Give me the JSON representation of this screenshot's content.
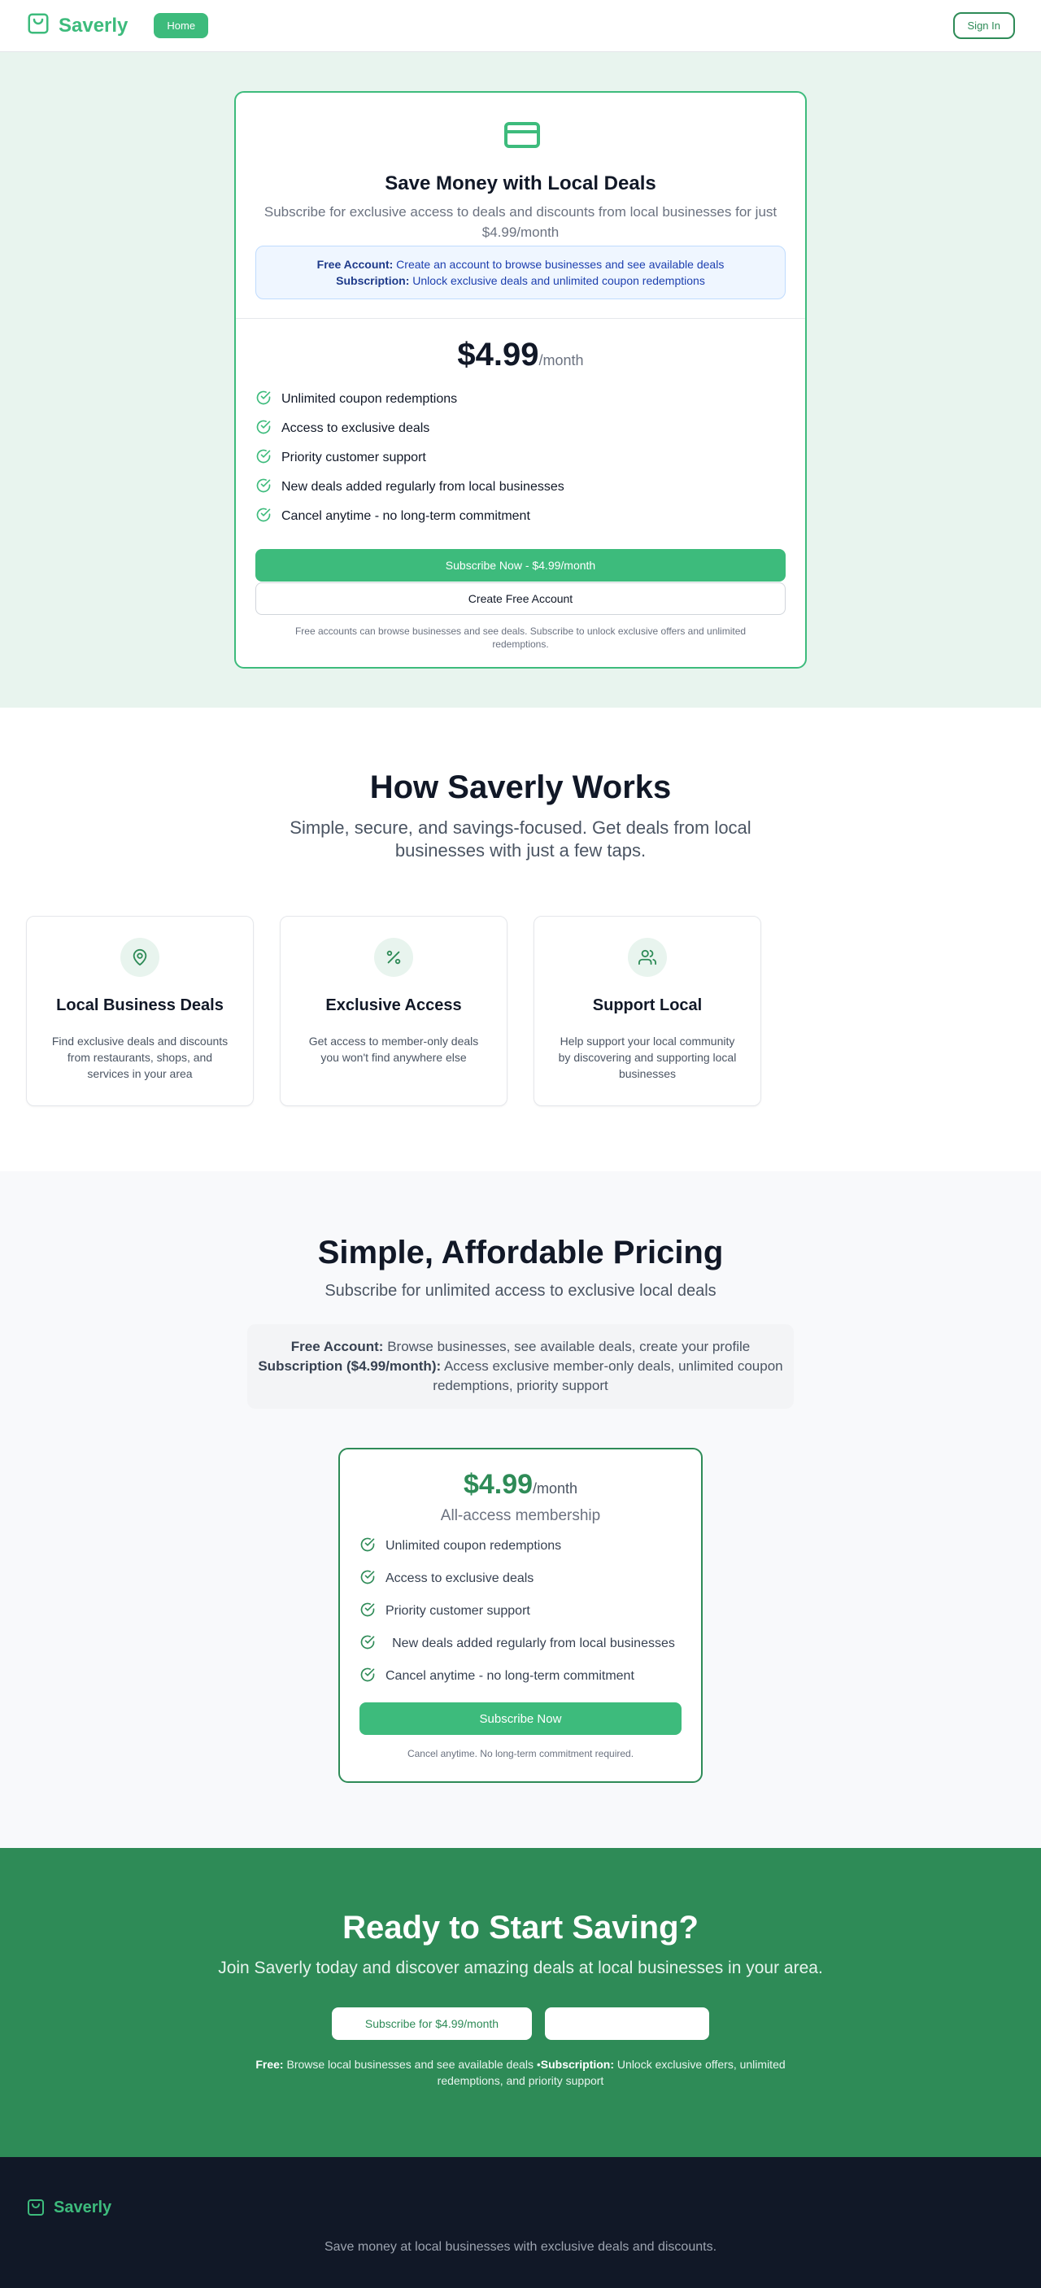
{
  "header": {
    "brand": "Saverly",
    "home_label": "Home",
    "signin_label": "Sign In"
  },
  "hero": {
    "title": "Save Money with Local Deals",
    "subtitle": "Subscribe for exclusive access to deals and discounts from local businesses for just $4.99/month",
    "free_label": "Free Account:",
    "free_text": "Create an account to browse businesses and see available deals",
    "sub_label": "Subscription:",
    "sub_text": "Unlock exclusive deals and unlimited coupon redemptions",
    "price": "$4.99",
    "per": "/month",
    "features": [
      "Unlimited coupon redemptions",
      "Access to exclusive deals",
      "Priority customer support",
      "New deals added regularly from local businesses",
      "Cancel anytime - no long-term commitment"
    ],
    "subscribe_label": "Subscribe Now - $4.99/month",
    "free_account_label": "Create Free Account",
    "note": "Free accounts can browse businesses and see deals. Subscribe to unlock exclusive offers and unlimited redemptions."
  },
  "how": {
    "title": "How Saverly Works",
    "subtitle": "Simple, secure, and savings-focused. Get deals from local businesses with just a few taps.",
    "cards": [
      {
        "icon": "map-pin-icon",
        "title": "Local Business Deals",
        "text": "Find exclusive deals and discounts from restaurants, shops, and services in your area"
      },
      {
        "icon": "percent-icon",
        "title": "Exclusive Access",
        "text": "Get access to member-only deals you won't find anywhere else"
      },
      {
        "icon": "users-icon",
        "title": "Support Local",
        "text": "Help support your local community by discovering and supporting local businesses"
      }
    ]
  },
  "pricing": {
    "title": "Simple, Affordable Pricing",
    "subtitle": "Subscribe for unlimited access to exclusive local deals",
    "free_label": "Free Account:",
    "free_text": "Browse businesses, see available deals, create your profile",
    "sub_label": "Subscription ($4.99/month):",
    "sub_text": "Access exclusive member-only deals, unlimited coupon redemptions, priority support",
    "price": "$4.99",
    "per": "/month",
    "tagline": "All-access membership",
    "features": [
      "Unlimited coupon redemptions",
      "Access to exclusive deals",
      "Priority customer support",
      "New deals added regularly from local businesses",
      "Cancel anytime - no long-term commitment"
    ],
    "button_label": "Subscribe Now",
    "note": "Cancel anytime. No long-term commitment required."
  },
  "cta": {
    "title": "Ready to Start Saving?",
    "subtitle": "Join Saverly today and discover amazing deals at local businesses in your area.",
    "btn1_label": "Subscribe for $4.99/month",
    "btn2_label": "",
    "free_label": "Free:",
    "free_text": "Browse local businesses and see available deals •",
    "sub_label": "Subscription:",
    "sub_text": "Unlock exclusive offers, unlimited redemptions, and priority support"
  },
  "footer": {
    "brand": "Saverly",
    "tagline": "Save money at local businesses with exclusive deals and discounts."
  },
  "colors": {
    "brand_green": "#3dbb7c",
    "dark_green": "#2e8b57",
    "footer_bg": "#111827"
  }
}
